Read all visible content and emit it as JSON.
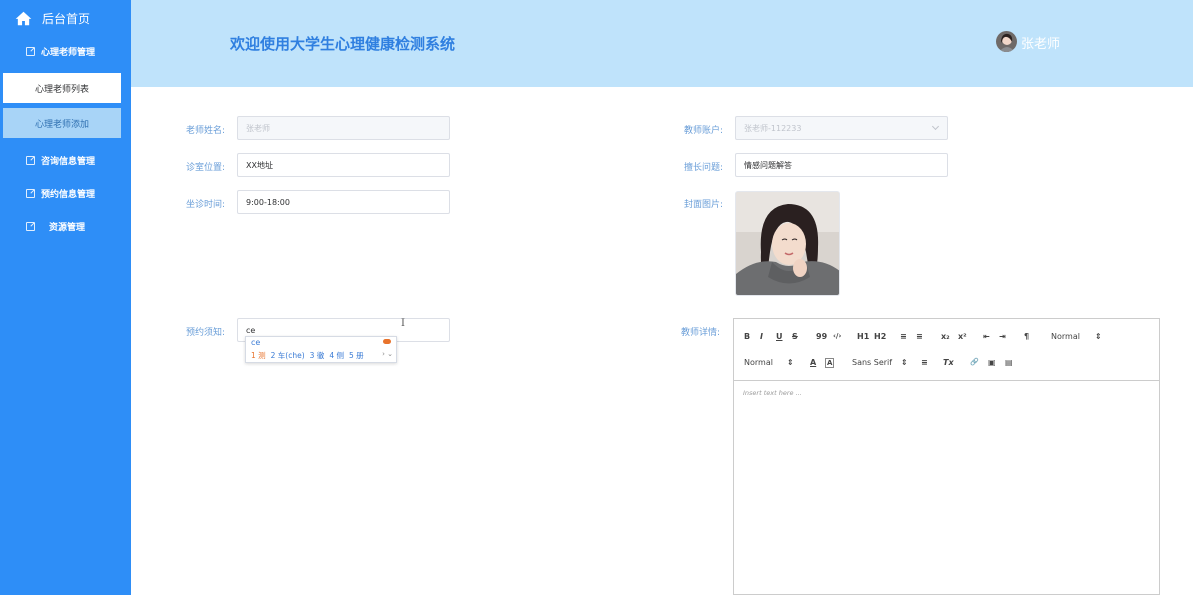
{
  "sidebar": {
    "home_label": "后台首页",
    "menus": [
      {
        "label": "心理老师管理"
      },
      {
        "label": "咨询信息管理"
      },
      {
        "label": "预约信息管理"
      },
      {
        "label": "资源管理"
      }
    ],
    "subitems": [
      {
        "label": "心理老师列表"
      },
      {
        "label": "心理老师添加"
      }
    ]
  },
  "header": {
    "title": "欢迎使用大学生心理健康检测系统",
    "user_name": "张老师"
  },
  "form": {
    "name": {
      "label": "老师姓名:",
      "value": "张老师"
    },
    "account": {
      "label": "教师账户:",
      "value": "张老师-112233"
    },
    "location": {
      "label": "诊室位置:",
      "value": "XX地址"
    },
    "specialty": {
      "label": "擅长问题:",
      "value": "情感问题解答"
    },
    "hours": {
      "label": "坐诊时间:",
      "value": "9:00-18:00"
    },
    "cover": {
      "label": "封面图片:"
    },
    "notice": {
      "label": "预约须知:",
      "value": "ce"
    },
    "detail": {
      "label": "教师详情:"
    }
  },
  "ime": {
    "typed": "ce",
    "candidates": [
      "1 测",
      "2 车(che)",
      "3 徹",
      "4 侧",
      "5 册"
    ],
    "more": "› ⌄"
  },
  "editor": {
    "toolbar_row1": [
      "B",
      "I",
      "U",
      "S",
      "99",
      "‹/›",
      "H1",
      "H2",
      "≡",
      "≡",
      "x₂",
      "x²",
      "⇤",
      "⇥",
      "¶",
      "Normal",
      "⇕"
    ],
    "toolbar_row2": [
      "Normal",
      "⇕",
      "A",
      "A",
      "Sans Serif",
      "⇕",
      "≡",
      "Tx",
      "🔗",
      "▣",
      "▤"
    ],
    "placeholder": "Insert text here ..."
  },
  "colors": {
    "sidebar": "#2e8ef7",
    "header": "#bfe3fb",
    "title": "#2f7fe0",
    "label": "#6a9ed8"
  }
}
